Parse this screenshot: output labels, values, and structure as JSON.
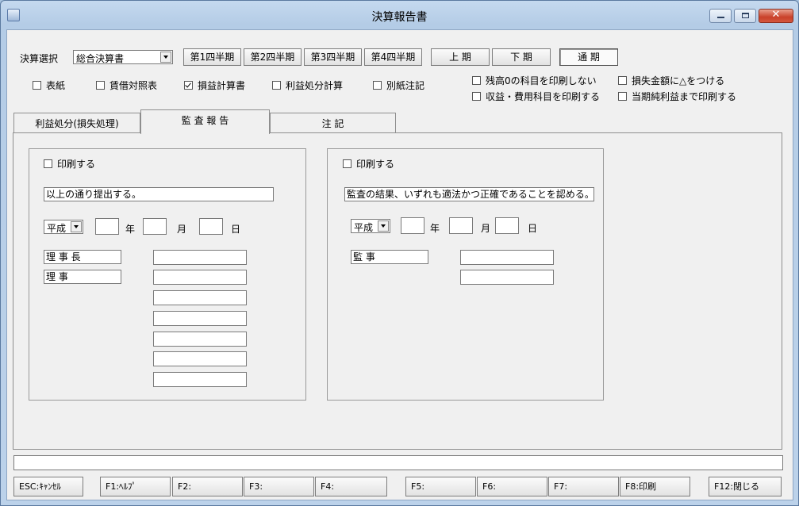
{
  "window": {
    "title": "決算報告書"
  },
  "selection": {
    "label": "決算選択",
    "value": "総合決算書"
  },
  "quarters": [
    "第1四半期",
    "第2四半期",
    "第3四半期",
    "第4四半期"
  ],
  "periods": [
    "上 期",
    "下 期",
    "通 期"
  ],
  "checkboxes_left": [
    {
      "label": "表紙",
      "checked": false
    },
    {
      "label": "賃借対照表",
      "checked": false
    },
    {
      "label": "損益計算書",
      "checked": true
    },
    {
      "label": "利益処分計算",
      "checked": false
    },
    {
      "label": "別紙注記",
      "checked": false
    }
  ],
  "checkboxes_right": [
    {
      "label": "残高0の科目を印刷しない",
      "checked": false
    },
    {
      "label": "損失金額に△をつける",
      "checked": false
    },
    {
      "label": "収益・費用科目を印刷する",
      "checked": false
    },
    {
      "label": "当期純利益まで印刷する",
      "checked": false
    }
  ],
  "tabs": [
    "利益処分(損失処理)",
    "監 査 報 告",
    "注  記"
  ],
  "left_group": {
    "print_label": "印刷する",
    "statement": "以上の通り提出する。",
    "era": "平成",
    "date_units": [
      "年",
      "月",
      "日"
    ],
    "roles": [
      "理 事 長",
      "理    事"
    ]
  },
  "right_group": {
    "print_label": "印刷する",
    "statement": "監査の結果、いずれも適法かつ正確であることを認める。",
    "era": "平成",
    "date_units": [
      "年",
      "月",
      "日"
    ],
    "roles": [
      "監    事"
    ]
  },
  "function_keys": [
    "ESC:ｷｬﾝｾﾙ",
    "F1:ﾍﾙﾌﾟ",
    "F2:",
    "F3:",
    "F4:",
    "F5:",
    "F6:",
    "F7:",
    "F8:印刷",
    "F12:閉じる"
  ]
}
